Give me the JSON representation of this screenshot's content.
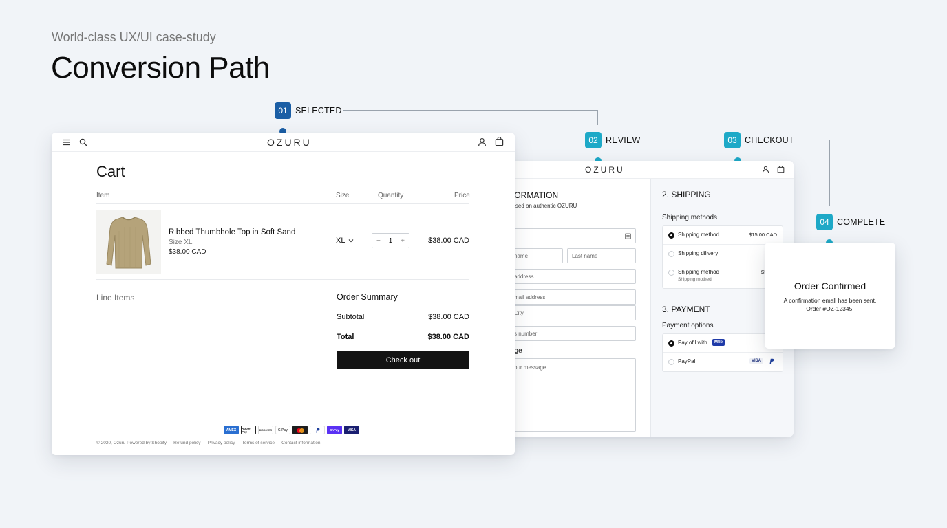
{
  "header": {
    "subtitle": "World-class UX/UI case-study",
    "title": "Conversion Path"
  },
  "steps": [
    {
      "num": "01",
      "label": "SELECTED"
    },
    {
      "num": "02",
      "label": "REVIEW"
    },
    {
      "num": "03",
      "label": "CHECKOUT"
    },
    {
      "num": "04",
      "label": "COMPLETE"
    }
  ],
  "colors": {
    "step_primary": "#1b5ea5",
    "step_accent": "#1ea9c7",
    "checkout_button": "#131313",
    "background": "#f1f4f8"
  },
  "cart": {
    "brand": "OZURU",
    "title": "Cart",
    "columns": {
      "item": "Item",
      "size": "Size",
      "quantity": "Quantity",
      "price": "Price"
    },
    "item": {
      "name": "Ribbed Thumbhole Top in Soft Sand",
      "size_line": "Size XL",
      "price_line": "$38.00 CAD",
      "size_value": "XL",
      "quantity": "1",
      "row_price": "$38.00 CAD"
    },
    "line_items_label": "Line Items",
    "summary": {
      "title": "Order Summary",
      "subtotal_label": "Subtotal",
      "subtotal_value": "$38.00 CAD",
      "total_label": "Total",
      "total_value": "$38.00 CAD",
      "checkout_label": "Check out"
    },
    "payment_icons": [
      "AMEX",
      "Apple Pay",
      "DISCOVER",
      "G Pay",
      "Mastercard",
      "PayPal",
      "Shop Pay",
      "VISA"
    ],
    "footer": {
      "copyright": "© 2020, Ozuru Powered by Shopify",
      "links": [
        "Refund policy",
        "Privacy policy",
        "Terms of service",
        "Contact information"
      ]
    }
  },
  "review": {
    "brand": "OZURU",
    "information": {
      "heading": "FORMATION",
      "sub": "based on authentic OZURU",
      "label_fragment": "l",
      "fields": {
        "first_name": "name",
        "last_name": "Last name",
        "address": "address",
        "email": "mail address",
        "city": "City",
        "phone": "s number"
      },
      "message_label": "age",
      "message_placeholder": "our message"
    },
    "shipping": {
      "heading": "2. SHIPPING",
      "subheading": "Shipping methods",
      "options": [
        {
          "label": "Shipping method",
          "price": "$15.00 CAD",
          "selected": true
        },
        {
          "label": "Shipping dilivery",
          "price": "",
          "selected": false
        },
        {
          "label": "Shipping method",
          "price": "$50.00",
          "sub": "Shipping mothed",
          "selected": false
        }
      ]
    },
    "payment": {
      "heading": "3. PAYMENT",
      "subheading": "Payment options",
      "options": [
        {
          "label": "Pay ofil with",
          "badge": "Mfle",
          "selected": true
        },
        {
          "label": "PayPal",
          "badge": "VISA",
          "selected": false
        }
      ]
    }
  },
  "confirmation": {
    "title": "Order Confirmed",
    "line1": "A confirmation emall has been sent.",
    "line2": "Order #OZ-12345."
  }
}
